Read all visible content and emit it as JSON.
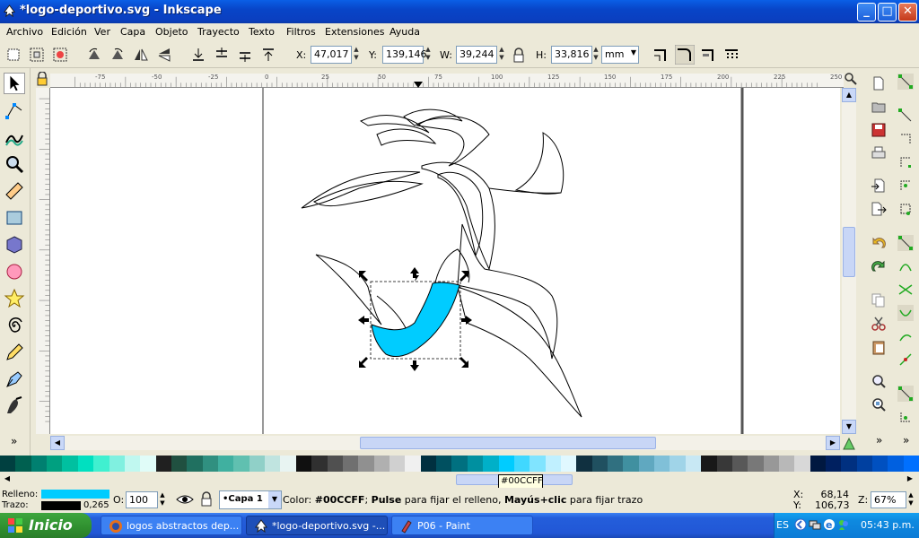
{
  "window": {
    "title": "*logo-deportivo.svg - Inkscape",
    "controls": {
      "minimize": "_",
      "maximize": "□",
      "close": "✕"
    }
  },
  "menu": [
    "Archivo",
    "Edición",
    "Ver",
    "Capa",
    "Objeto",
    "Trayecto",
    "Texto",
    "Filtros",
    "Extensiones",
    "Ayuda"
  ],
  "toolbar": {
    "x_label": "X:",
    "x_value": "47,017",
    "y_label": "Y:",
    "y_value": "139,146",
    "w_label": "W:",
    "w_value": "39,244",
    "h_label": "H:",
    "h_value": "33,816",
    "unit": "mm"
  },
  "ruler": {
    "h_ticks": [
      "-75",
      "-50",
      "-25",
      "0",
      "25",
      "50",
      "75",
      "100",
      "125",
      "150",
      "175",
      "200",
      "225",
      "250"
    ],
    "v_ticks": [
      "7",
      "1",
      "2",
      "5",
      "1",
      "0",
      "0",
      "7",
      "5"
    ]
  },
  "palette": {
    "colors": [
      "#004040",
      "#006050",
      "#008070",
      "#00A080",
      "#00C0A0",
      "#00E0C0",
      "#40F0D0",
      "#80F0E0",
      "#C0F8F0",
      "#E0FCF8",
      "#202020",
      "#205040",
      "#207060",
      "#309080",
      "#40B0A0",
      "#60C0B0",
      "#90D0C8",
      "#C0E4E0",
      "#E8F4F2",
      "#101010",
      "#303030",
      "#505050",
      "#707070",
      "#909090",
      "#B0B0B0",
      "#D0D0D0",
      "#F0F0F0",
      "#003040",
      "#005060",
      "#007080",
      "#0090A0",
      "#00B0C8",
      "#00CCFF",
      "#40D8FF",
      "#80E4FF",
      "#C0F0FF",
      "#E0F8FF",
      "#103040",
      "#205060",
      "#307080",
      "#4090A0",
      "#60A8C0",
      "#80C0D8",
      "#A0D4E8",
      "#C8E8F4",
      "#181818",
      "#383838",
      "#585858",
      "#787878",
      "#989898",
      "#B8B8B8",
      "#D8D8D8",
      "#001840",
      "#002060",
      "#003080",
      "#0040A0",
      "#0050C0",
      "#0060E0",
      "#0070FF"
    ],
    "tooltip": "#00CCFF"
  },
  "status": {
    "fill_label": "Relleno:",
    "stroke_label": "Trazo:",
    "fill_color": "#00CCFF",
    "stroke_color": "#000000",
    "stroke_width": "0,265",
    "opacity_label": "O:",
    "opacity_value": "100",
    "layer": "•Capa 1",
    "message_prefix": "Color: ",
    "message_color": "#00CCFF",
    "message_mid1": "; ",
    "message_pulse": "Pulse",
    "message_mid2": " para fijar el relleno, ",
    "message_shift": "Mayús+clic",
    "message_end": " para fijar trazo",
    "x_label": "X:",
    "x_value": "68,14",
    "y_label": "Y:",
    "y_value": "106,73",
    "zoom_label": "Z:",
    "zoom_value": "67%"
  },
  "taskbar": {
    "start": "Inicio",
    "tasks": [
      "logos abstractos dep...",
      "*logo-deportivo.svg -...",
      "P06 - Paint"
    ],
    "lang": "ES",
    "clock": "05:43 p.m."
  }
}
